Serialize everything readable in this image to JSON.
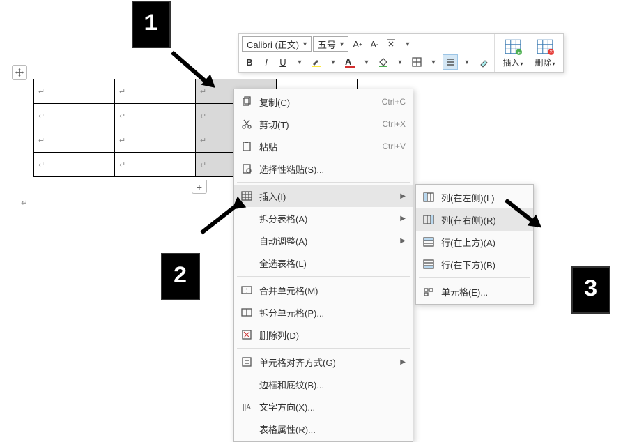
{
  "toolbar": {
    "font_name": "Calibri (正文)",
    "font_size": "五号",
    "inc_font_tip": "A",
    "dec_font_tip": "A",
    "bold": "B",
    "italic": "I",
    "underline": "U",
    "insert_label": "插入",
    "delete_label": "删除"
  },
  "context_menu": {
    "copy": "复制(C)",
    "copy_sc": "Ctrl+C",
    "cut": "剪切(T)",
    "cut_sc": "Ctrl+X",
    "paste": "粘贴",
    "paste_sc": "Ctrl+V",
    "paste_special": "选择性粘贴(S)...",
    "insert": "插入(I)",
    "split_table": "拆分表格(A)",
    "autofit": "自动调整(A)",
    "select_all_table": "全选表格(L)",
    "merge_cells": "合并单元格(M)",
    "split_cells": "拆分单元格(P)...",
    "delete_col": "删除列(D)",
    "cell_align": "单元格对齐方式(G)",
    "borders": "边框和底纹(B)...",
    "text_dir": "文字方向(X)...",
    "table_props": "表格属性(R)..."
  },
  "submenu": {
    "col_left": "列(在左侧)(L)",
    "col_right": "列(在右侧)(R)",
    "row_above": "行(在上方)(A)",
    "row_below": "行(在下方)(B)",
    "cell": "单元格(E)..."
  },
  "callouts": {
    "c1": "1",
    "c2": "2",
    "c3": "3"
  }
}
